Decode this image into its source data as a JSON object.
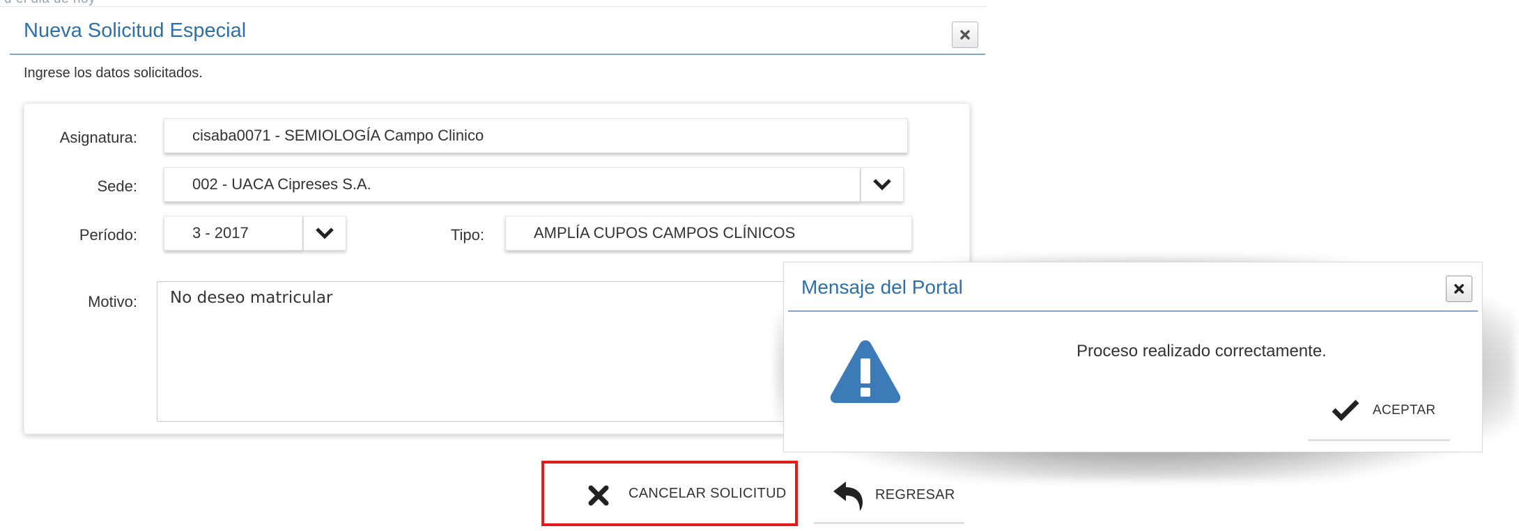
{
  "header_cutoff_text": "d el dia de hoy",
  "dialog": {
    "title": "Nueva Solicitud Especial",
    "instructions": "Ingrese los datos solicitados.",
    "form": {
      "asignatura": {
        "label": "Asignatura:",
        "value": "cisaba0071 - SEMIOLOGÍA Campo Clinico"
      },
      "sede": {
        "label": "Sede:",
        "value": "002 - UACA Cipreses S.A."
      },
      "periodo": {
        "label": "Período:",
        "value": "3 - 2017"
      },
      "tipo": {
        "label": "Tipo:",
        "value": "AMPLÍA CUPOS CAMPOS CLÍNICOS"
      },
      "motivo": {
        "label": "Motivo:",
        "value": "No deseo matricular"
      }
    },
    "buttons": {
      "cancel_label": "CANCELAR SOLICITUD",
      "back_label": "REGRESAR"
    }
  },
  "modal": {
    "title": "Mensaje del Portal",
    "message": "Proceso realizado correctamente.",
    "accept_label": "ACEPTAR"
  },
  "colors": {
    "title_blue": "#2f6fa8",
    "highlight_red": "#e51b1b",
    "warning_blue": "#3d7ab8"
  }
}
